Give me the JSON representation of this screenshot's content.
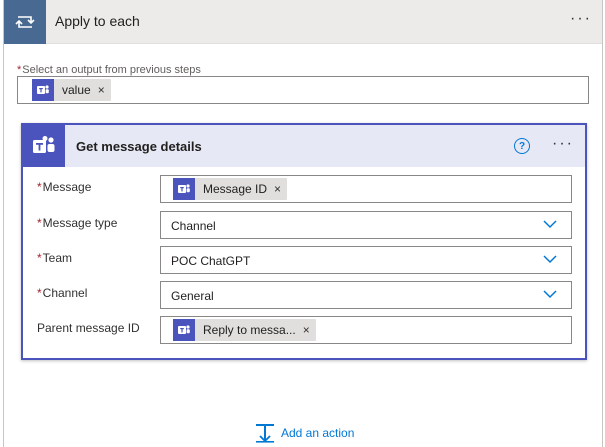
{
  "apply_to_each": {
    "title": "Apply to each",
    "more_label": "···",
    "select_label": "Select an output from previous steps",
    "required_mark": "*",
    "token": {
      "label": "value",
      "remove": "×",
      "icon": "teams-icon"
    }
  },
  "action": {
    "title": "Get message details",
    "help_label": "?",
    "more_label": "···",
    "icon": "teams-icon",
    "fields": {
      "message": {
        "label": "Message",
        "required": "*",
        "token_label": "Message ID",
        "remove": "×"
      },
      "message_type": {
        "label": "Message type",
        "required": "*",
        "value": "Channel"
      },
      "team": {
        "label": "Team",
        "required": "*",
        "value": "POC ChatGPT"
      },
      "channel": {
        "label": "Channel",
        "required": "*",
        "value": "General"
      },
      "parent_message_id": {
        "label": "Parent message ID",
        "token_label": "Reply to messa...",
        "remove": "×"
      }
    }
  },
  "footer": {
    "add_action_label": "Add an action"
  },
  "colors": {
    "teams_purple": "#4b53bc",
    "loop_blue": "#486991",
    "link_blue": "#0078d4",
    "required_red": "#a4262c"
  }
}
